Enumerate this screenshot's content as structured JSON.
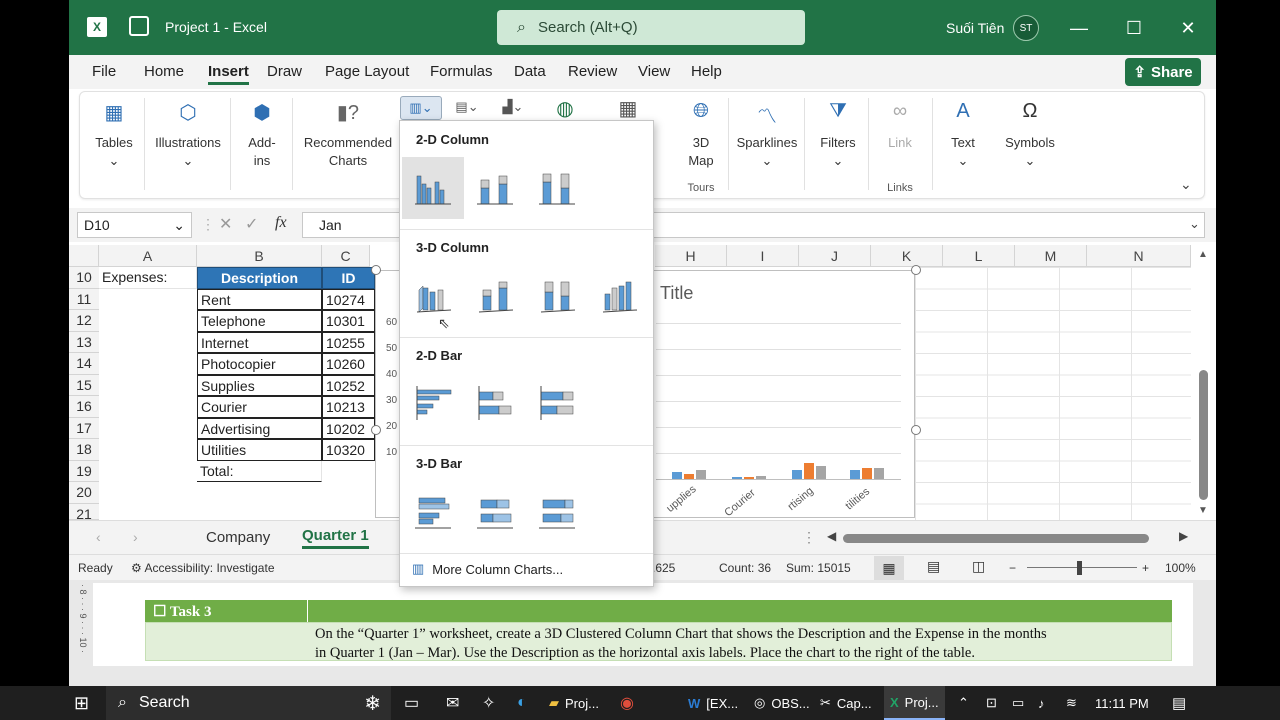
{
  "window": {
    "title": "Project 1  -  Excel",
    "search_placeholder": "Search (Alt+Q)",
    "user_name": "Suối Tiên",
    "user_initials": "ST"
  },
  "menu": {
    "items": [
      "File",
      "Home",
      "Insert",
      "Draw",
      "Page Layout",
      "Formulas",
      "Data",
      "Review",
      "View",
      "Help"
    ],
    "active": "Insert",
    "share_label": "Share"
  },
  "ribbon": {
    "tables": "Tables",
    "illustrations": "Illustrations",
    "addins_1": "Add-",
    "addins_2": "ins",
    "recommended_1": "Recommended",
    "recommended_2": "Charts",
    "map_1": "3D",
    "map_2": "Map",
    "tours": "Tours",
    "sparklines": "Sparklines",
    "filters": "Filters",
    "link": "Link",
    "links": "Links",
    "text": "Text",
    "symbols": "Symbols"
  },
  "formula_bar": {
    "name_box": "D10",
    "fx": "fx",
    "value": "Jan"
  },
  "columns": [
    "A",
    "B",
    "C",
    "H",
    "I",
    "J",
    "K",
    "L",
    "M",
    "N"
  ],
  "rows": [
    "10",
    "11",
    "12",
    "13",
    "14",
    "15",
    "16",
    "17",
    "18",
    "19",
    "20",
    "21"
  ],
  "cells": {
    "a10": "Expenses:",
    "desc_header": "Description",
    "id_header": "ID",
    "descriptions": [
      "Rent",
      "Telephone",
      "Internet",
      "Photocopier",
      "Supplies",
      "Courier",
      "Advertising",
      "Utilities"
    ],
    "ids": [
      "10274",
      "10301",
      "10255",
      "10260",
      "10252",
      "10213",
      "10202",
      "10320"
    ],
    "total": "Total:"
  },
  "chart": {
    "title": "Title",
    "yticks": [
      "60",
      "50",
      "40",
      "30",
      "20",
      "10"
    ],
    "xlabels": [
      "upplies",
      "Courier",
      "rtising",
      "tilities"
    ],
    "series_colors": [
      "#5b9bd5",
      "#ed7d31",
      "#a5a5a5"
    ]
  },
  "dropdown": {
    "sec_2d_col": "2-D Column",
    "sec_3d_col": "3-D Column",
    "sec_2d_bar": "2-D Bar",
    "sec_3d_bar": "3-D Bar",
    "more": "More Column Charts..."
  },
  "sheets": {
    "tabs": [
      "Company",
      "Quarter 1"
    ],
    "active": "Quarter 1"
  },
  "status": {
    "ready": "Ready",
    "accessibility": "Accessibility: Investigate",
    "average": ".625",
    "count": "Count: 36",
    "sum": "Sum: 15015",
    "zoom": "100%"
  },
  "task": {
    "heading": "☐ Task 3",
    "line1": "On the “Quarter 1” worksheet, create a 3D Clustered Column Chart that shows the Description and the Expense in the months",
    "line2": "in Quarter 1 (Jan – Mar). Use the Description as the horizontal axis labels. Place the chart to the right of the table."
  },
  "taskbar": {
    "search": "Search",
    "apps": [
      "Proj...",
      "[EX...",
      "OBS...",
      "Cap...",
      "Proj..."
    ],
    "time": "11:11 PM"
  }
}
